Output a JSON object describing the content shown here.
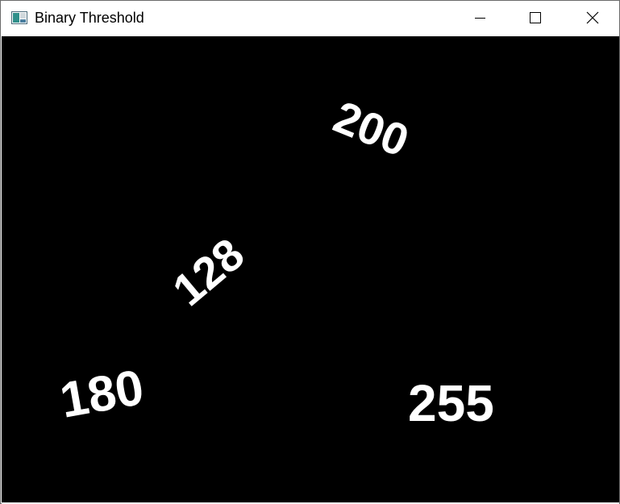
{
  "window": {
    "title": "Binary Threshold",
    "icon": "opencv-window-icon",
    "controls": {
      "minimize_icon": "minimize-icon",
      "maximize_icon": "maximize-icon",
      "close_icon": "close-icon"
    }
  },
  "image": {
    "background_color": "#000000",
    "text_color": "#ffffff",
    "labels": [
      {
        "text": "200"
      },
      {
        "text": "128"
      },
      {
        "text": "180"
      },
      {
        "text": "255"
      }
    ]
  }
}
